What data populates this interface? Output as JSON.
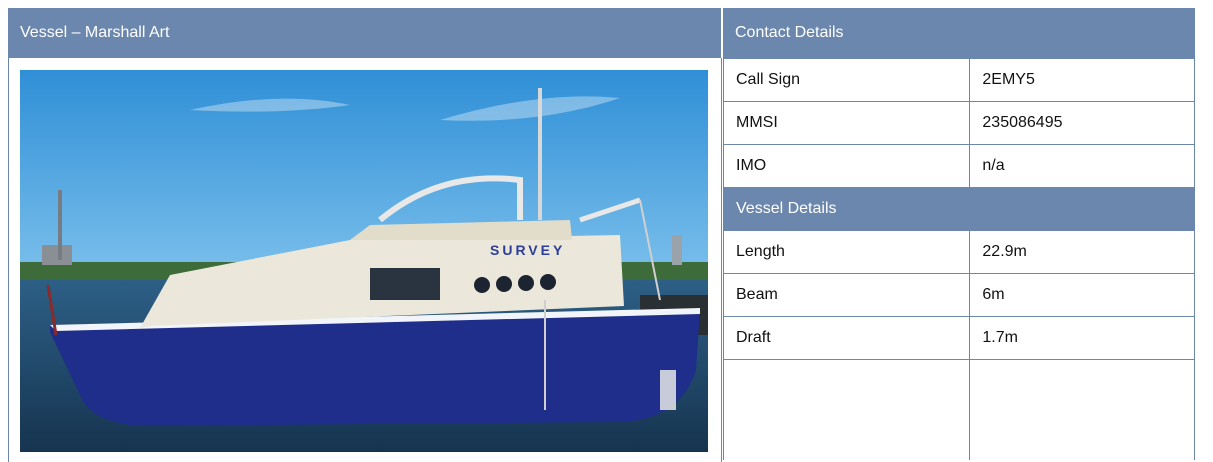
{
  "vessel_header": "Vessel – Marshall Art",
  "contact_header": "Contact  Details",
  "contact_rows": [
    {
      "label": "Call Sign",
      "value": "2EMY5"
    },
    {
      "label": "MMSI",
      "value": "235086495"
    },
    {
      "label": "IMO",
      "value": "n/a"
    }
  ],
  "vessel_details_header": "Vessel Details",
  "vessel_rows": [
    {
      "label": "Length",
      "value": "22.9m"
    },
    {
      "label": "Beam",
      "value": "6m"
    },
    {
      "label": "Draft",
      "value": "1.7m"
    }
  ],
  "hull_text": "SURVEY",
  "colors": {
    "header_bg": "#6b87ad",
    "hull": "#1e2e8a"
  }
}
